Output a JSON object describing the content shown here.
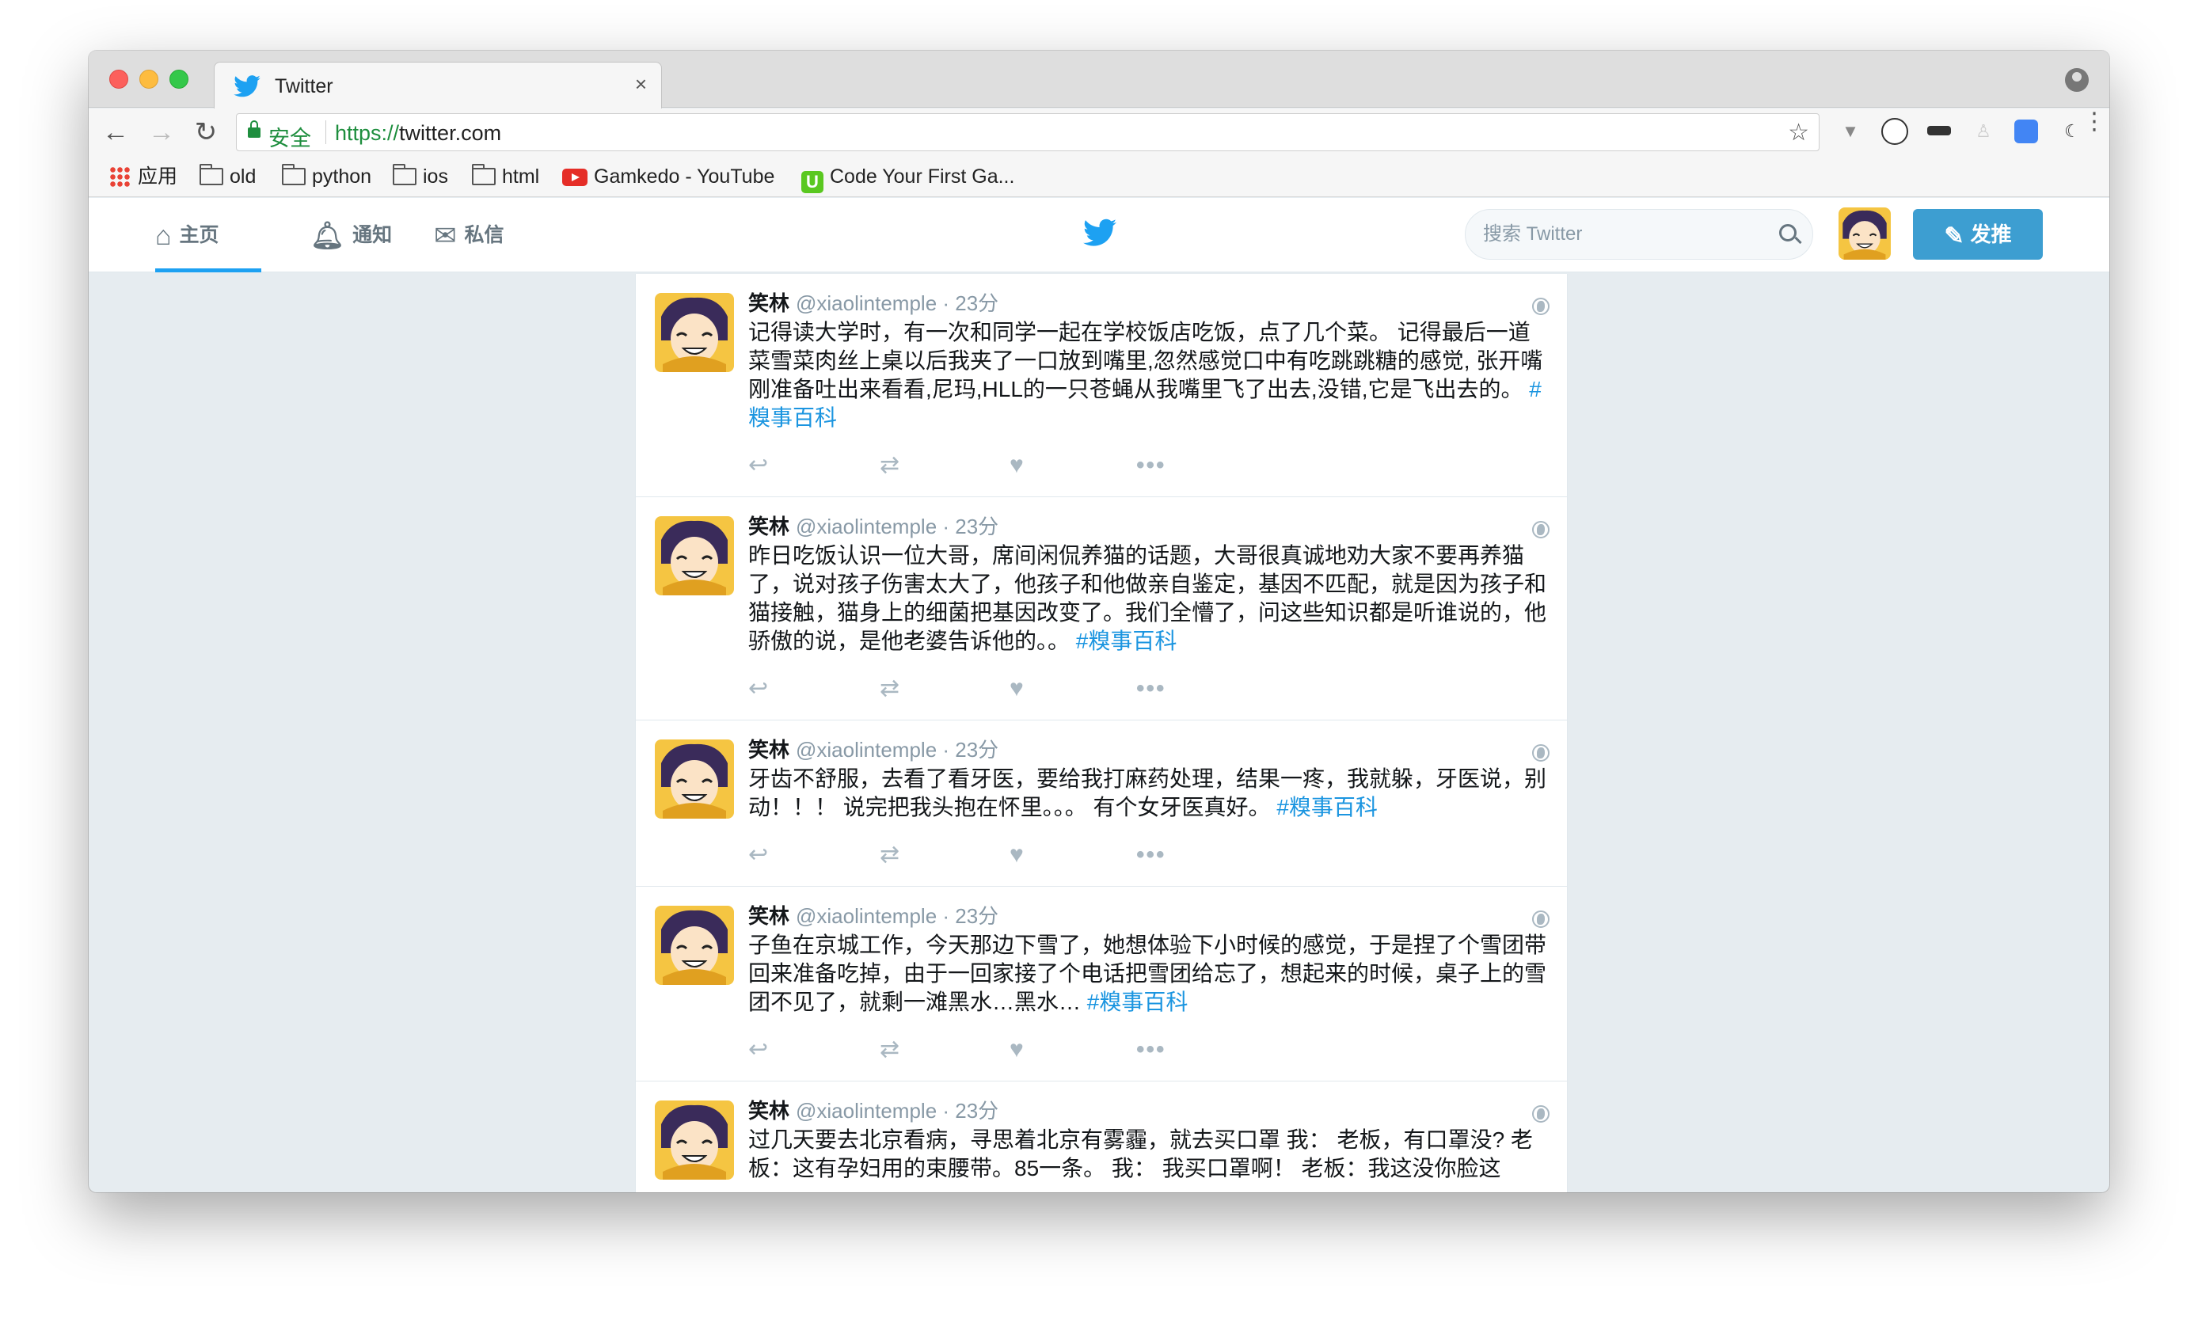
{
  "browser": {
    "tab_title": "Twitter",
    "tab_close": "×",
    "secure_label": "安全",
    "url_scheme": "https://",
    "url_host": "twitter.com",
    "star_icon": "☆",
    "back_icon": "←",
    "forward_icon": "→",
    "reload_icon": "↻"
  },
  "bookmarks": {
    "apps": "应用",
    "folders": [
      "old",
      "python",
      "ios",
      "html"
    ],
    "youtube": "Gamkedo - YouTube",
    "codeyourfirst": "Code Your First Ga...",
    "u_icon": "U"
  },
  "twitter": {
    "nav": {
      "home": "主页",
      "notifications": "通知",
      "messages": "私信"
    },
    "search_placeholder": "搜索 Twitter",
    "tweet_button": "发推",
    "brand_color": "#1da1f2"
  },
  "tweets": [
    {
      "name": "笑林",
      "handle": "@xiaolintemple",
      "time": " · 23分",
      "text": "记得读大学时，有一次和同学一起在学校饭店吃饭，点了几个菜。 记得最后一道菜雪菜肉丝上桌以后我夹了一口放到嘴里,忽然感觉口中有吃跳跳糖的感觉, 张开嘴刚准备吐出来看看,尼玛,HLL的一只苍蝇从我嘴里飞了出去,没错,它是飞出去的。 ",
      "hashtag": "#糗事百科"
    },
    {
      "name": "笑林",
      "handle": "@xiaolintemple",
      "time": " · 23分",
      "text": "昨日吃饭认识一位大哥，席间闲侃养猫的话题，大哥很真诚地劝大家不要再养猫了，说对孩子伤害太大了，他孩子和他做亲自鉴定，基因不匹配，就是因为孩子和猫接触，猫身上的细菌把基因改变了。我们全懵了，问这些知识都是听谁说的，他骄傲的说，是他老婆告诉他的。。 ",
      "hashtag": "#糗事百科"
    },
    {
      "name": "笑林",
      "handle": "@xiaolintemple",
      "time": " · 23分",
      "text": "牙齿不舒服，去看了看牙医，要给我打麻药处理，结果一疼，我就躲，牙医说，别动！！！ 说完把我头抱在怀里。。。 有个女牙医真好。 ",
      "hashtag": "#糗事百科"
    },
    {
      "name": "笑林",
      "handle": "@xiaolintemple",
      "time": " · 23分",
      "text": "子鱼在京城工作，今天那边下雪了，她想体验下小时候的感觉，于是捏了个雪团带回来准备吃掉，由于一回家接了个电话把雪团给忘了，想起来的时候，桌子上的雪团不见了，就剩一滩黑水…黑水… ",
      "hashtag": "#糗事百科"
    },
    {
      "name": "笑林",
      "handle": "@xiaolintemple",
      "time": " · 23分",
      "text": "过几天要去北京看病，寻思着北京有雾霾，就去买口罩 我：  老板，有口罩没? 老板：这有孕妇用的束腰带。85一条。 我：  我买口罩啊！ 老板：我这没你脸这",
      "hashtag": ""
    }
  ],
  "actions": {
    "reply": "↩",
    "retweet": "⇄",
    "like": "♥",
    "more": "•••"
  }
}
